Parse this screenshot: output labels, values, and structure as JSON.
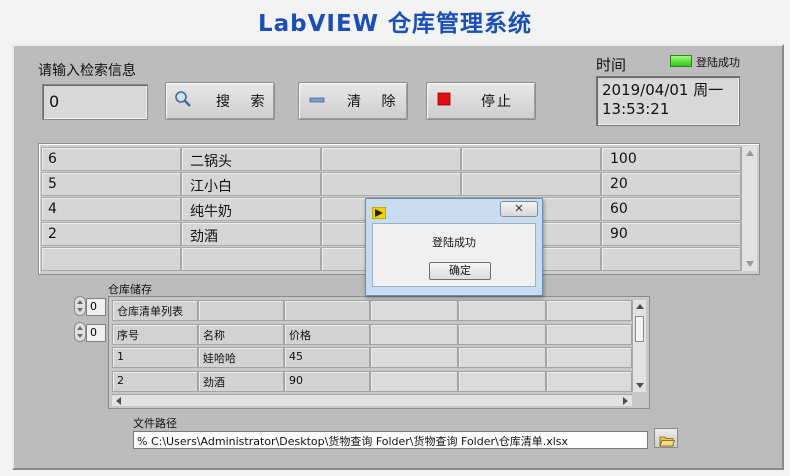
{
  "app": {
    "title": "LabVIEW 仓库管理系统"
  },
  "search": {
    "label": "请输入检索信息",
    "value": "0",
    "search_button": "搜 索",
    "clear_button": "清 除",
    "stop_button": "停止"
  },
  "status": {
    "time_label": "时间",
    "date": "2019/04/01 周一",
    "time": "13:53:21",
    "login_label": "登陆成功",
    "led_color": "#3fd82a"
  },
  "result_table": {
    "rows": [
      [
        "6",
        "二锅头",
        "",
        "",
        "100"
      ],
      [
        "5",
        "江小白",
        "",
        "",
        "20"
      ],
      [
        "4",
        "纯牛奶",
        "",
        "",
        "60"
      ],
      [
        "2",
        "劲酒",
        "",
        "",
        "90"
      ],
      [
        "",
        "",
        "",
        "",
        ""
      ]
    ]
  },
  "storage": {
    "label": "仓库储存",
    "row_index": "0",
    "col_index": "0",
    "rows": [
      [
        "仓库清单列表",
        "",
        "",
        "",
        "",
        ""
      ],
      [
        "序号",
        "名称",
        "价格",
        "",
        "",
        ""
      ],
      [
        "1",
        "娃哈哈",
        "45",
        "",
        "",
        ""
      ],
      [
        "2",
        "劲酒",
        "90",
        "",
        "",
        ""
      ]
    ]
  },
  "file": {
    "label": "文件路径",
    "path_prefix": "%",
    "path": "C:\\Users\\Administrator\\Desktop\\货物查询 Folder\\货物查询 Folder\\仓库清单.xlsx"
  },
  "dialog": {
    "message": "登陆成功",
    "ok_button": "确定",
    "close_glyph": "✕"
  }
}
